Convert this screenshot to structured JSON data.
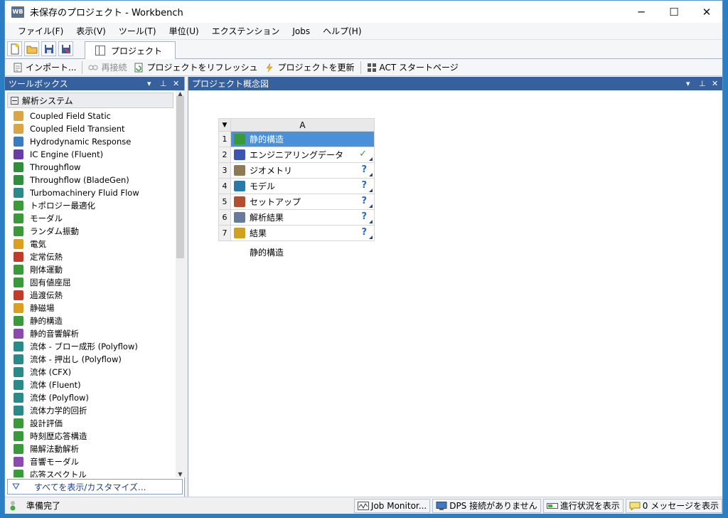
{
  "window": {
    "title": "未保存のプロジェクト - Workbench",
    "app_icon": "WB",
    "minimize": "─",
    "maximize": "☐",
    "close": "✕"
  },
  "menu": [
    "ファイル(F)",
    "表示(V)",
    "ツール(T)",
    "単位(U)",
    "エクステンション",
    "Jobs",
    "ヘルプ(H)"
  ],
  "tabs": {
    "project": "プロジェクト"
  },
  "toolbar": {
    "import": "インポート...",
    "reconnect": "再接続",
    "refresh": "プロジェクトをリフレッシュ",
    "update": "プロジェクトを更新",
    "act_start": "ACT スタートページ"
  },
  "toolbox": {
    "title": "ツールボックス",
    "group": "解析システム",
    "items": [
      {
        "label": "Coupled Field Static",
        "icon_color": "#d9a646"
      },
      {
        "label": "Coupled Field Transient",
        "icon_color": "#d9a646"
      },
      {
        "label": "Hydrodynamic Response",
        "icon_color": "#3b7bbf"
      },
      {
        "label": "IC Engine (Fluent)",
        "icon_color": "#6a3da6"
      },
      {
        "label": "Throughflow",
        "icon_color": "#2f8f3a"
      },
      {
        "label": "Throughflow (BladeGen)",
        "icon_color": "#2f8f3a"
      },
      {
        "label": "Turbomachinery Fluid Flow",
        "icon_color": "#2a8a8a"
      },
      {
        "label": "トポロジー最適化",
        "icon_color": "#3a9a3a"
      },
      {
        "label": "モーダル",
        "icon_color": "#3a9a3a"
      },
      {
        "label": "ランダム振動",
        "icon_color": "#3a9a3a"
      },
      {
        "label": "電気",
        "icon_color": "#d9a020"
      },
      {
        "label": "定常伝熱",
        "icon_color": "#c23a2a"
      },
      {
        "label": "剛体運動",
        "icon_color": "#3a9a3a"
      },
      {
        "label": "固有値座屈",
        "icon_color": "#3a9a3a"
      },
      {
        "label": "過渡伝熱",
        "icon_color": "#c23a2a"
      },
      {
        "label": "静磁場",
        "icon_color": "#d9a020"
      },
      {
        "label": "静的構造",
        "icon_color": "#3a9a3a"
      },
      {
        "label": "静的音響解析",
        "icon_color": "#8a4ab0"
      },
      {
        "label": "流体 - ブロー成形 (Polyflow)",
        "icon_color": "#2a8a8a"
      },
      {
        "label": "流体 - 押出し (Polyflow)",
        "icon_color": "#2a8a8a"
      },
      {
        "label": "流体 (CFX)",
        "icon_color": "#2a8a8a"
      },
      {
        "label": "流体 (Fluent)",
        "icon_color": "#2a8a8a"
      },
      {
        "label": "流体 (Polyflow)",
        "icon_color": "#2a8a8a"
      },
      {
        "label": "流体力学的回折",
        "icon_color": "#2a8a8a"
      },
      {
        "label": "設計評価",
        "icon_color": "#3a9a3a"
      },
      {
        "label": "時刻歴応答構造",
        "icon_color": "#3a9a3a"
      },
      {
        "label": "陽解法動解析",
        "icon_color": "#3a9a3a"
      },
      {
        "label": "音響モーダル",
        "icon_color": "#8a4ab0"
      },
      {
        "label": "応答スペクトル",
        "icon_color": "#3a9a3a"
      }
    ],
    "footer": "すべてを表示/カスタマイズ..."
  },
  "schematic": {
    "title": "プロジェクト概念図",
    "system": {
      "column": "A",
      "name": "静的構造",
      "rows": [
        {
          "num": "1",
          "label": "静的構造",
          "status": "",
          "icon_color": "#3a9a3a"
        },
        {
          "num": "2",
          "label": "エンジニアリングデータ",
          "status": "✓",
          "icon_color": "#3b55b0"
        },
        {
          "num": "3",
          "label": "ジオメトリ",
          "status": "?",
          "icon_color": "#8a7a55"
        },
        {
          "num": "4",
          "label": "モデル",
          "status": "?",
          "icon_color": "#2a7aa8"
        },
        {
          "num": "5",
          "label": "セットアップ",
          "status": "?",
          "icon_color": "#b05030"
        },
        {
          "num": "6",
          "label": "解析結果",
          "status": "?",
          "icon_color": "#6a7a9a"
        },
        {
          "num": "7",
          "label": "結果",
          "status": "?",
          "icon_color": "#d0a020"
        }
      ]
    }
  },
  "status": {
    "ready": "準備完了",
    "job_monitor": "Job Monitor...",
    "dps": "DPS 接続がありません",
    "progress": "進行状況を表示",
    "messages": "0 メッセージを表示"
  }
}
